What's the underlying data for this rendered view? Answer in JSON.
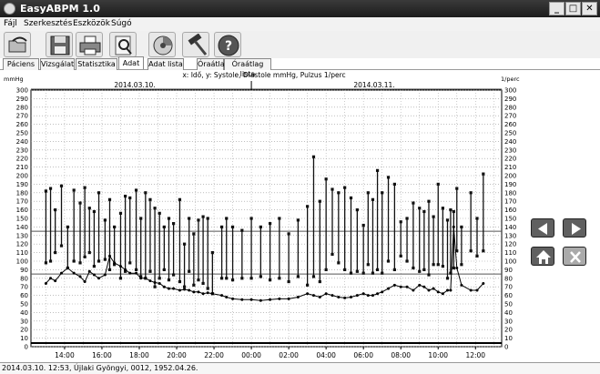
{
  "window": {
    "title": "EasyABPM 1.0"
  },
  "menu": [
    {
      "label": "Fájl"
    },
    {
      "label": "Szerkesztés"
    },
    {
      "label": "Eszközök"
    },
    {
      "label": "Súgó"
    }
  ],
  "toolbar": [
    {
      "name": "open-icon"
    },
    {
      "name": "save-icon"
    },
    {
      "name": "print-icon"
    },
    {
      "name": "zoom-icon"
    },
    {
      "name": "device-icon"
    },
    {
      "name": "hammer-icon"
    },
    {
      "name": "help-icon"
    }
  ],
  "tabs": [
    {
      "label": "Páciens"
    },
    {
      "label": "Vizsgálat"
    },
    {
      "label": "Statisztika"
    },
    {
      "label": "Adat"
    },
    {
      "label": "Adat lista"
    },
    {
      "label": "Óraátlag"
    },
    {
      "label": "Óraátlag lista"
    }
  ],
  "active_tab": "Adat",
  "status": {
    "text": "2014.03.10. 12:53, Újlaki Gyöngyi, 0012, 1952.04.26."
  },
  "chart_data": {
    "type": "line",
    "subtitle": "x: Idő,  y: Systole, Diastole mmHg, Pulzus 1/perc",
    "ylabel_left": "mmHg",
    "ylabel_right": "1/perc",
    "dates": [
      "2014.03.10.",
      "2014.03.11."
    ],
    "ylim": [
      0,
      300
    ],
    "xticks": [
      "14:00",
      "16:00",
      "18:00",
      "20:00",
      "22:00",
      "00:00",
      "02:00",
      "04:00",
      "06:00",
      "08:00",
      "10:00",
      "12:00"
    ],
    "reference_lines": [
      135,
      85
    ],
    "measurements": [
      {
        "t": "13:00",
        "sys": 182,
        "dia": 98,
        "pulse": 74
      },
      {
        "t": "13:15",
        "sys": 185,
        "dia": 100,
        "pulse": 80
      },
      {
        "t": "13:30",
        "sys": 160,
        "dia": 110,
        "pulse": 77
      },
      {
        "t": "13:50",
        "sys": 188,
        "dia": 118,
        "pulse": 86
      },
      {
        "t": "14:10",
        "sys": 140,
        "dia": 92,
        "pulse": 92
      },
      {
        "t": "14:30",
        "sys": 183,
        "dia": 100,
        "pulse": 86
      },
      {
        "t": "14:50",
        "sys": 168,
        "dia": 98,
        "pulse": 82
      },
      {
        "t": "15:05",
        "sys": 186,
        "dia": 105,
        "pulse": 76
      },
      {
        "t": "15:20",
        "sys": 162,
        "dia": 110,
        "pulse": 88
      },
      {
        "t": "15:35",
        "sys": 158,
        "dia": 94,
        "pulse": 84
      },
      {
        "t": "15:50",
        "sys": 180,
        "dia": 100,
        "pulse": 80
      },
      {
        "t": "16:10",
        "sys": 148,
        "dia": 102,
        "pulse": 84
      },
      {
        "t": "16:25",
        "sys": 172,
        "dia": 90,
        "pulse": 106
      },
      {
        "t": "16:40",
        "sys": 140,
        "dia": 96,
        "pulse": 98
      },
      {
        "t": "17:00",
        "sys": 156,
        "dia": 80,
        "pulse": 94
      },
      {
        "t": "17:15",
        "sys": 176,
        "dia": 88,
        "pulse": 90
      },
      {
        "t": "17:30",
        "sys": 174,
        "dia": 98,
        "pulse": 86
      },
      {
        "t": "17:50",
        "sys": 183,
        "dia": 90,
        "pulse": 86
      },
      {
        "t": "18:05",
        "sys": 150,
        "dia": 82,
        "pulse": 80
      },
      {
        "t": "18:20",
        "sys": 180,
        "dia": 80,
        "pulse": 80
      },
      {
        "t": "18:35",
        "sys": 172,
        "dia": 88,
        "pulse": 77
      },
      {
        "t": "18:50",
        "sys": 162,
        "dia": 70,
        "pulse": 75
      },
      {
        "t": "19:05",
        "sys": 156,
        "dia": 80,
        "pulse": 74
      },
      {
        "t": "19:20",
        "sys": 140,
        "dia": 90,
        "pulse": 70
      },
      {
        "t": "19:35",
        "sys": 150,
        "dia": 78,
        "pulse": 68
      },
      {
        "t": "19:50",
        "sys": 144,
        "dia": 84,
        "pulse": 68
      },
      {
        "t": "20:10",
        "sys": 172,
        "dia": 76,
        "pulse": 66
      },
      {
        "t": "20:25",
        "sys": 120,
        "dia": 70,
        "pulse": 67
      },
      {
        "t": "20:40",
        "sys": 150,
        "dia": 88,
        "pulse": 66
      },
      {
        "t": "20:55",
        "sys": 132,
        "dia": 72,
        "pulse": 64
      },
      {
        "t": "21:10",
        "sys": 148,
        "dia": 78,
        "pulse": 64
      },
      {
        "t": "21:25",
        "sys": 152,
        "dia": 74,
        "pulse": 62
      },
      {
        "t": "21:40",
        "sys": 150,
        "dia": 68,
        "pulse": 63
      },
      {
        "t": "21:55",
        "sys": 110,
        "dia": 62,
        "pulse": 62
      },
      {
        "t": "22:25",
        "sys": 140,
        "dia": 80,
        "pulse": 60
      },
      {
        "t": "22:40",
        "sys": 150,
        "dia": 80,
        "pulse": 58
      },
      {
        "t": "23:00",
        "sys": 140,
        "dia": 78,
        "pulse": 56
      },
      {
        "t": "23:30",
        "sys": 136,
        "dia": 80,
        "pulse": 55
      },
      {
        "t": "00:00",
        "sys": 150,
        "dia": 80,
        "pulse": 55
      },
      {
        "t": "00:30",
        "sys": 140,
        "dia": 82,
        "pulse": 54
      },
      {
        "t": "01:00",
        "sys": 144,
        "dia": 78,
        "pulse": 55
      },
      {
        "t": "01:30",
        "sys": 150,
        "dia": 80,
        "pulse": 56
      },
      {
        "t": "02:00",
        "sys": 132,
        "dia": 76,
        "pulse": 56
      },
      {
        "t": "02:30",
        "sys": 148,
        "dia": 82,
        "pulse": 58
      },
      {
        "t": "03:00",
        "sys": 164,
        "dia": 72,
        "pulse": 62
      },
      {
        "t": "03:20",
        "sys": 222,
        "dia": 82,
        "pulse": 60
      },
      {
        "t": "03:40",
        "sys": 170,
        "dia": 76,
        "pulse": 58
      },
      {
        "t": "04:00",
        "sys": 196,
        "dia": 90,
        "pulse": 62
      },
      {
        "t": "04:20",
        "sys": 184,
        "dia": 108,
        "pulse": 60
      },
      {
        "t": "04:40",
        "sys": 180,
        "dia": 98,
        "pulse": 58
      },
      {
        "t": "05:00",
        "sys": 186,
        "dia": 90,
        "pulse": 57
      },
      {
        "t": "05:20",
        "sys": 174,
        "dia": 86,
        "pulse": 58
      },
      {
        "t": "05:40",
        "sys": 160,
        "dia": 88,
        "pulse": 60
      },
      {
        "t": "06:00",
        "sys": 142,
        "dia": 86,
        "pulse": 62
      },
      {
        "t": "06:15",
        "sys": 180,
        "dia": 96,
        "pulse": 60
      },
      {
        "t": "06:30",
        "sys": 172,
        "dia": 86,
        "pulse": 60
      },
      {
        "t": "06:45",
        "sys": 206,
        "dia": 90,
        "pulse": 62
      },
      {
        "t": "07:00",
        "sys": 180,
        "dia": 86,
        "pulse": 64
      },
      {
        "t": "07:20",
        "sys": 198,
        "dia": 100,
        "pulse": 68
      },
      {
        "t": "07:40",
        "sys": 190,
        "dia": 90,
        "pulse": 72
      },
      {
        "t": "08:00",
        "sys": 146,
        "dia": 106,
        "pulse": 70
      },
      {
        "t": "08:20",
        "sys": 150,
        "dia": 100,
        "pulse": 70
      },
      {
        "t": "08:40",
        "sys": 168,
        "dia": 92,
        "pulse": 66
      },
      {
        "t": "09:00",
        "sys": 162,
        "dia": 88,
        "pulse": 72
      },
      {
        "t": "09:15",
        "sys": 158,
        "dia": 90,
        "pulse": 70
      },
      {
        "t": "09:30",
        "sys": 170,
        "dia": 84,
        "pulse": 66
      },
      {
        "t": "09:45",
        "sys": 152,
        "dia": 96,
        "pulse": 68
      },
      {
        "t": "10:00",
        "sys": 190,
        "dia": 96,
        "pulse": 64
      },
      {
        "t": "10:15",
        "sys": 162,
        "dia": 94,
        "pulse": 62
      },
      {
        "t": "10:30",
        "sys": 148,
        "dia": 80,
        "pulse": 66
      },
      {
        "t": "10:40",
        "sys": 160,
        "dia": 86,
        "pulse": 66
      },
      {
        "t": "10:50",
        "sys": 158,
        "dia": 92,
        "pulse": 140
      },
      {
        "t": "11:00",
        "sys": 185,
        "dia": 112,
        "pulse": 92
      },
      {
        "t": "11:15",
        "sys": 140,
        "dia": 96,
        "pulse": 72
      },
      {
        "t": "11:45",
        "sys": 180,
        "dia": 112,
        "pulse": 66
      },
      {
        "t": "12:05",
        "sys": 150,
        "dia": 106,
        "pulse": 66
      },
      {
        "t": "12:25",
        "sys": 202,
        "dia": 112,
        "pulse": 74
      }
    ]
  }
}
